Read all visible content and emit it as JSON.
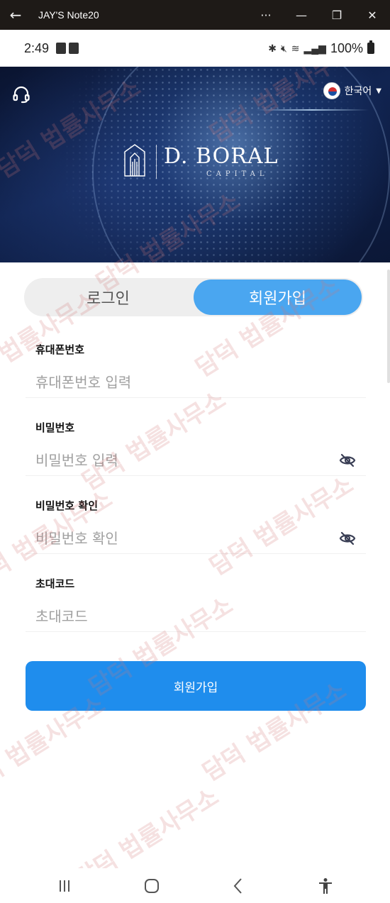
{
  "window": {
    "title": "JAY'S Note20"
  },
  "status_bar": {
    "time": "2:49",
    "battery": "100%"
  },
  "header": {
    "language_label": "한국어",
    "logo_name": "D. BORAL",
    "logo_sub": "CAPITAL"
  },
  "tabs": [
    {
      "label": "로그인",
      "active": false
    },
    {
      "label": "회원가입",
      "active": true
    }
  ],
  "form": {
    "phone": {
      "label": "휴대폰번호",
      "placeholder": "휴대폰번호 입력"
    },
    "password": {
      "label": "비밀번호",
      "placeholder": "비밀번호 입력"
    },
    "password_confirm": {
      "label": "비밀번호 확인",
      "placeholder": "비밀번호 확인"
    },
    "invite_code": {
      "label": "초대코드",
      "placeholder": "초대코드"
    },
    "submit_label": "회원가입"
  },
  "watermark_text": "담덕 법률사무소",
  "colors": {
    "primary": "#1f8ded",
    "tab_active": "#4aa6f0",
    "tab_bg": "#eeeeee"
  }
}
